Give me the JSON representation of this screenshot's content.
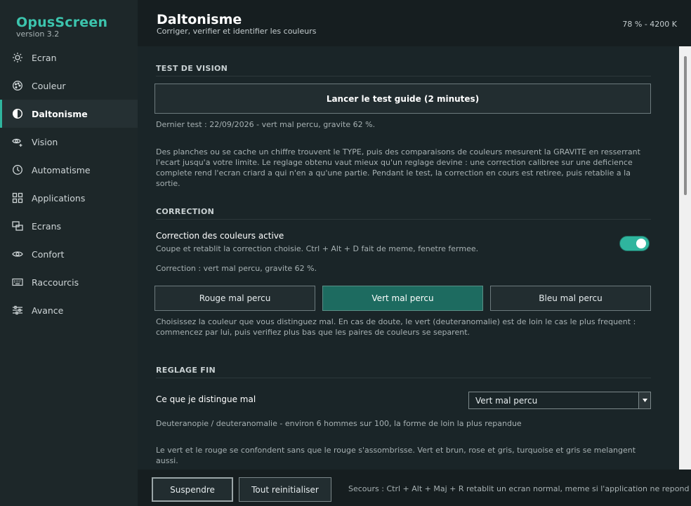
{
  "app": {
    "name": "OpusScreen",
    "version": "version 3.2"
  },
  "sidebar": {
    "items": [
      {
        "label": "Ecran",
        "icon": "sun-icon"
      },
      {
        "label": "Couleur",
        "icon": "palette-icon"
      },
      {
        "label": "Daltonisme",
        "icon": "half-circle-icon",
        "active": true
      },
      {
        "label": "Vision",
        "icon": "eye-plus-icon"
      },
      {
        "label": "Automatisme",
        "icon": "clock-icon"
      },
      {
        "label": "Applications",
        "icon": "apps-grid-icon"
      },
      {
        "label": "Ecrans",
        "icon": "monitors-icon"
      },
      {
        "label": "Confort",
        "icon": "eye-icon"
      },
      {
        "label": "Raccourcis",
        "icon": "keyboard-icon"
      },
      {
        "label": "Avance",
        "icon": "sliders-icon"
      }
    ]
  },
  "header": {
    "title": "Daltonisme",
    "subtitle": "Corriger, verifier et identifier les couleurs",
    "status": "78 % - 4200 K"
  },
  "test": {
    "section_title": "TEST DE VISION",
    "button_label": "Lancer le test guide (2 minutes)",
    "last_test": "Dernier test : 22/09/2026 - vert mal percu, gravite 62 %.",
    "description": "Des planches ou se cache un chiffre trouvent le TYPE, puis des comparaisons de couleurs mesurent la GRAVITE en resserrant l'ecart jusqu'a votre limite. Le reglage obtenu vaut mieux qu'un reglage devine : une correction calibree sur une deficience complete rend l'ecran criard a qui n'en a qu'une partie. Pendant le test, la correction en cours est retiree, puis retablie a la sortie."
  },
  "correction": {
    "section_title": "CORRECTION",
    "toggle_label": "Correction des couleurs active",
    "toggle_desc": "Coupe et retablit la correction choisie. Ctrl + Alt + D fait de meme, fenetre fermee.",
    "enabled": true,
    "current": "Correction : vert mal percu, gravite 62 %.",
    "options": [
      "Rouge mal percu",
      "Vert mal percu",
      "Bleu mal percu"
    ],
    "selected_index": 1,
    "hint": "Choisissez la couleur que vous distinguez mal. En cas de doute, le vert (deuteranomalie) est de loin le cas le plus frequent : commencez par lui, puis verifiez plus bas que les paires de couleurs se separent."
  },
  "fine": {
    "section_title": "REGLAGE FIN",
    "label": "Ce que je distingue mal",
    "select_value": "Vert mal percu",
    "type_desc": "Deuteranopie / deuteranomalie - environ 6 hommes sur 100, la forme de loin la plus repandue",
    "effect_desc": "Le vert et le rouge se confondent sans que le rouge s'assombrisse. Vert et brun, rose et gris, turquoise et gris se melangent aussi."
  },
  "footer": {
    "suspend_label": "Suspendre",
    "reset_label": "Tout reinitialiser",
    "note": "Secours : Ctrl + Alt + Maj + R retablit un ecran normal, meme si l'application ne repond plus."
  },
  "colors": {
    "accent": "#2fb59e",
    "brand": "#3cc4ad",
    "selected": "#1d6b60"
  }
}
